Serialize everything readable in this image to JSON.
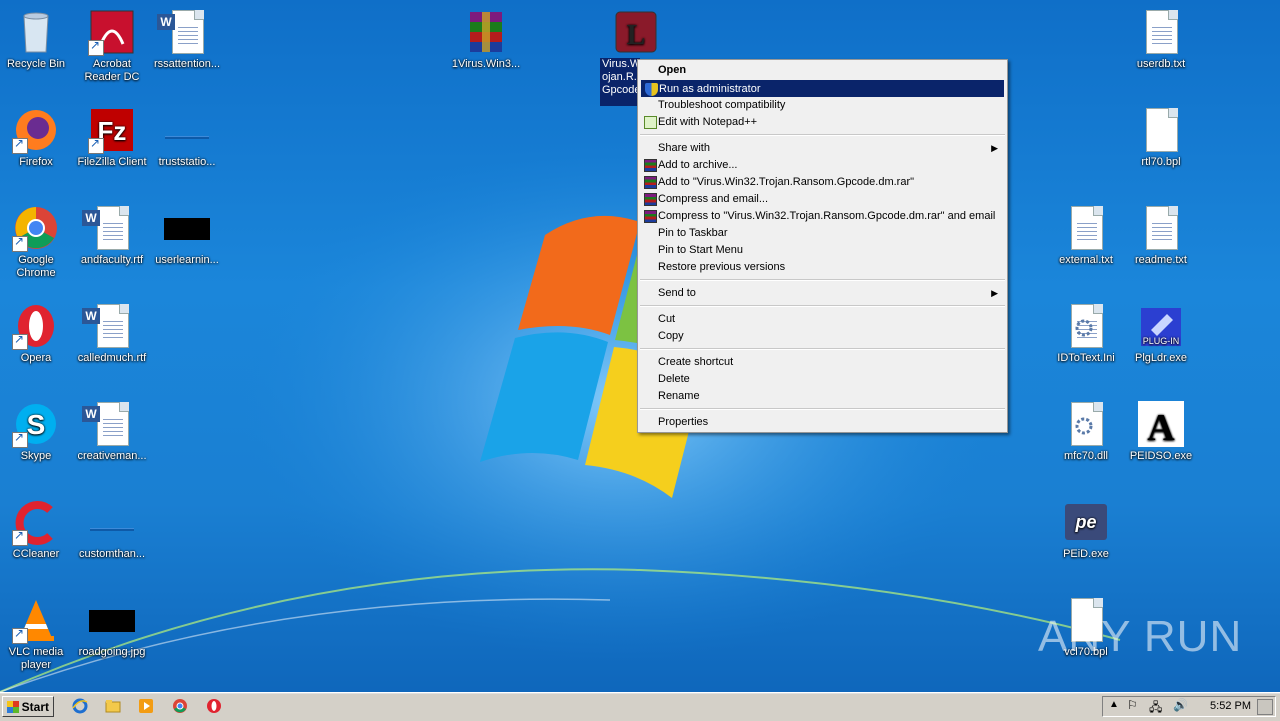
{
  "desktop": {
    "icons_left": [
      {
        "label": "Recycle Bin",
        "icon": "recycle-bin-icon"
      },
      {
        "label": "Acrobat Reader DC",
        "icon": "acrobat-icon"
      },
      {
        "label": "rssattention...",
        "icon": "word-doc-icon"
      },
      {
        "label": "Firefox",
        "icon": "firefox-icon"
      },
      {
        "label": "FileZilla Client",
        "icon": "filezilla-icon"
      },
      {
        "label": "truststatio...",
        "icon": "blank-file-icon"
      },
      {
        "label": "Google Chrome",
        "icon": "chrome-icon"
      },
      {
        "label": "andfaculty.rtf",
        "icon": "word-doc-icon"
      },
      {
        "label": "userlearnin...",
        "icon": "black-image-icon"
      },
      {
        "label": "Opera",
        "icon": "opera-icon"
      },
      {
        "label": "calledmuch.rtf",
        "icon": "word-doc-icon"
      },
      {
        "label": "Skype",
        "icon": "skype-icon"
      },
      {
        "label": "creativeman...",
        "icon": "word-doc-icon"
      },
      {
        "label": "CCleaner",
        "icon": "ccleaner-icon"
      },
      {
        "label": "customthan...",
        "icon": "blank-file-icon"
      },
      {
        "label": "VLC media player",
        "icon": "vlc-icon"
      },
      {
        "label": "roadgoing.jpg",
        "icon": "black-image-icon"
      }
    ],
    "icons_top": [
      {
        "label": "1Virus.Win3...",
        "icon": "winrar-icon"
      },
      {
        "label": "Virus.W... ojan.R... Gpcode...",
        "icon": "selected-exe-icon"
      }
    ],
    "icons_right": [
      {
        "label": "userdb.txt",
        "icon": "text-file-icon"
      },
      {
        "label": "rtl70.bpl",
        "icon": "blank-file-icon"
      },
      {
        "label": "external.txt",
        "icon": "text-file-icon"
      },
      {
        "label": "readme.txt",
        "icon": "text-file-icon"
      },
      {
        "label": "IDToText.Ini",
        "icon": "ini-file-icon"
      },
      {
        "label": "PlgLdr.exe",
        "icon": "plugin-icon"
      },
      {
        "label": "mfc70.dll",
        "icon": "dll-icon"
      },
      {
        "label": "PEIDSO.exe",
        "icon": "peidso-icon"
      },
      {
        "label": "PEiD.exe",
        "icon": "peid-icon"
      },
      {
        "label": "vcl70.bpl",
        "icon": "blank-file-icon"
      }
    ]
  },
  "context_menu": {
    "items": [
      {
        "label": "Open",
        "bold": true
      },
      {
        "label": "Run as administrator",
        "icon": "shield-icon",
        "highlighted": true
      },
      {
        "label": "Troubleshoot compatibility"
      },
      {
        "label": "Edit with Notepad++",
        "icon": "notepadpp-icon"
      },
      {
        "label": "Share with",
        "submenu": true
      },
      {
        "label": "Add to archive...",
        "icon": "winrar-icon"
      },
      {
        "label": "Add to \"Virus.Win32.Trojan.Ransom.Gpcode.dm.rar\"",
        "icon": "winrar-icon"
      },
      {
        "label": "Compress and email...",
        "icon": "winrar-icon"
      },
      {
        "label": "Compress to \"Virus.Win32.Trojan.Ransom.Gpcode.dm.rar\" and email",
        "icon": "winrar-icon"
      },
      {
        "label": "Pin to Taskbar"
      },
      {
        "label": "Pin to Start Menu"
      },
      {
        "label": "Restore previous versions"
      },
      {
        "label": "Send to",
        "submenu": true
      },
      {
        "label": "Cut"
      },
      {
        "label": "Copy"
      },
      {
        "label": "Create shortcut"
      },
      {
        "label": "Delete"
      },
      {
        "label": "Rename"
      },
      {
        "label": "Properties"
      }
    ]
  },
  "taskbar": {
    "start_label": "Start",
    "clock": "5:52 PM",
    "quick_launch": [
      "ie-icon",
      "explorer-icon",
      "media-player-icon",
      "chrome-icon",
      "opera-icon"
    ]
  },
  "watermark": "ANY RUN"
}
